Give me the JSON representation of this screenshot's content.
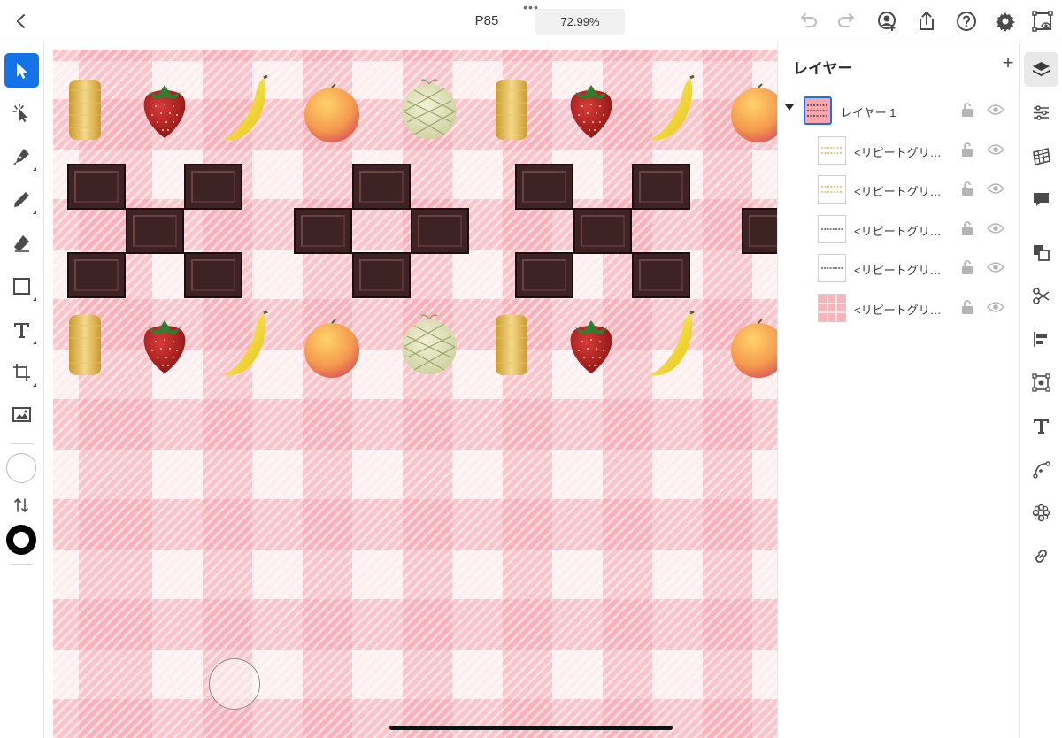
{
  "topbar": {
    "title": "P85",
    "more_dots": "•••",
    "zoom": "72.99%",
    "icons": [
      "back-icon",
      "undo-icon",
      "redo-icon",
      "invite-icon",
      "share-icon",
      "help-icon",
      "settings-icon",
      "preview-icon"
    ]
  },
  "tools": {
    "items": [
      {
        "name": "selection-tool",
        "icon": "arrow-icon",
        "active": true
      },
      {
        "name": "direct-selection-tool",
        "icon": "sparkle-arrow-icon"
      },
      {
        "name": "pen-tool",
        "icon": "pen-icon"
      },
      {
        "name": "pencil-tool",
        "icon": "pencil-icon"
      },
      {
        "name": "eraser-tool",
        "icon": "eraser-icon"
      },
      {
        "name": "rectangle-tool",
        "icon": "rectangle-icon"
      },
      {
        "name": "type-tool",
        "icon": "type-icon"
      },
      {
        "name": "transform-tool",
        "icon": "transform-icon"
      },
      {
        "name": "place-image-tool",
        "icon": "image-icon"
      }
    ],
    "fill_color": "#ffffff",
    "stroke_color": "#000000"
  },
  "canvas": {
    "pattern_colors": {
      "background": "#ffeef0",
      "check": "#fba0ac"
    },
    "artwork": [
      "cookie",
      "strawberry",
      "banana",
      "orange",
      "melon",
      "chocolate"
    ]
  },
  "layers_panel": {
    "title": "レイヤー",
    "add_label": "+",
    "layers": [
      {
        "label": "レイヤー 1",
        "expanded": true,
        "selected": true
      },
      {
        "label": "<リピートグリ…"
      },
      {
        "label": "<リピートグリ…"
      },
      {
        "label": "<リピートグリ…"
      },
      {
        "label": "<リピートグリ…"
      },
      {
        "label": "<リピートグリ…"
      }
    ]
  },
  "rail": {
    "icons": [
      "layers-icon",
      "properties-icon",
      "libraries-icon",
      "comments-icon",
      "arrange-icon",
      "scissors-icon",
      "align-icon",
      "selection-frame-icon",
      "type-settings-icon",
      "path-icon",
      "pattern-icon",
      "link-icon"
    ],
    "accent": "#1473e6"
  }
}
